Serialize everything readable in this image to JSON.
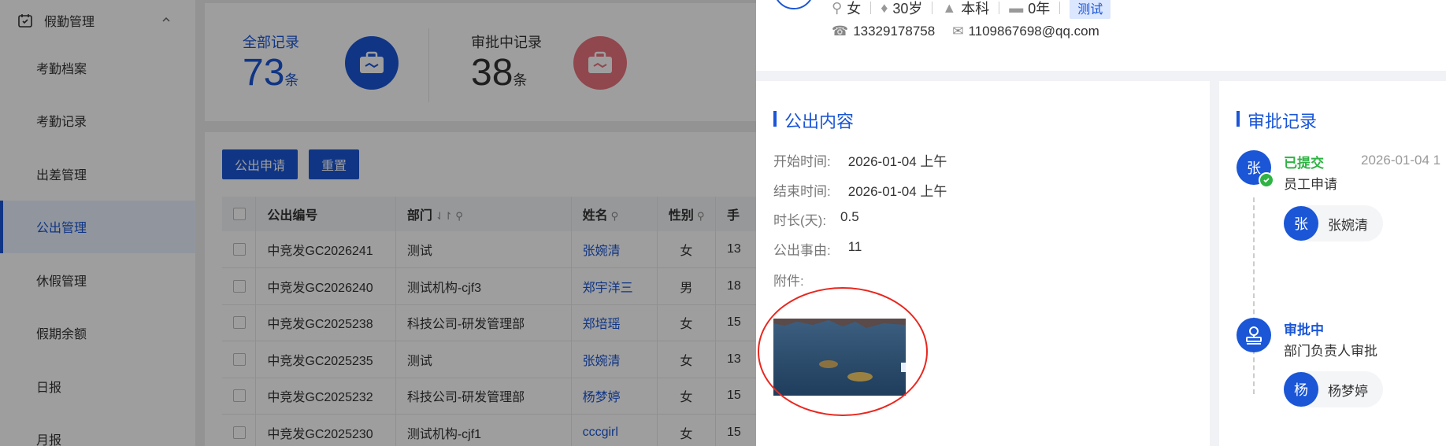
{
  "sidebar": {
    "group_label": "假勤管理",
    "items": [
      {
        "label": "考勤档案"
      },
      {
        "label": "考勤记录"
      },
      {
        "label": "出差管理"
      },
      {
        "label": "公出管理",
        "active": true
      },
      {
        "label": "休假管理"
      },
      {
        "label": "假期余额"
      },
      {
        "label": "日报"
      },
      {
        "label": "月报"
      }
    ]
  },
  "stats": {
    "all": {
      "label": "全部记录",
      "value": "73",
      "unit": "条"
    },
    "pending": {
      "label": "审批中记录",
      "value": "38",
      "unit": "条"
    }
  },
  "toolbar": {
    "apply_label": "公出申请",
    "reset_label": "重置"
  },
  "table": {
    "headers": {
      "number": "公出编号",
      "dept": "部门",
      "name": "姓名",
      "gender": "性别",
      "phone": "手"
    },
    "rows": [
      {
        "number": "中竞发GC2026241",
        "dept": "测试",
        "name": "张婉清",
        "gender": "女",
        "phone": "13"
      },
      {
        "number": "中竞发GC2026240",
        "dept": "测试机构-cjf3",
        "name": "郑宇洋三",
        "gender": "男",
        "phone": "18"
      },
      {
        "number": "中竞发GC2025238",
        "dept": "科技公司-研发管理部",
        "name": "郑培瑶",
        "gender": "女",
        "phone": "15"
      },
      {
        "number": "中竞发GC2025235",
        "dept": "测试",
        "name": "张婉清",
        "gender": "女",
        "phone": "13"
      },
      {
        "number": "中竞发GC2025232",
        "dept": "科技公司-研发管理部",
        "name": "杨梦婷",
        "gender": "女",
        "phone": "15"
      },
      {
        "number": "中竞发GC2025230",
        "dept": "测试机构-cjf1",
        "name": "cccgirl",
        "gender": "女",
        "phone": "15"
      }
    ]
  },
  "profile": {
    "gender": "女",
    "age": "30岁",
    "education": "本科",
    "tenure": "0年",
    "tag": "测试",
    "phone": "13329178758",
    "email": "1109867698@qq.com"
  },
  "content": {
    "title": "公出内容",
    "start_label": "开始时间:",
    "start_value": "2026-01-04 上午",
    "end_label": "结束时间:",
    "end_value": "2026-01-04 上午",
    "duration_label": "时长(天):",
    "duration_value": "0.5",
    "reason_label": "公出事由:",
    "reason_value": "11",
    "attachment_label": "附件:"
  },
  "approval": {
    "title": "审批记录",
    "steps": [
      {
        "avatar": "张",
        "status": "已提交",
        "date": "2026-01-04 1",
        "desc": "员工申请",
        "person_avatar": "张",
        "person_name": "张婉清"
      },
      {
        "status": "审批中",
        "desc": "部门负责人审批",
        "person_avatar": "杨",
        "person_name": "杨梦婷"
      }
    ]
  },
  "colors": {
    "primary": "#1a56d6",
    "success": "#2fb344",
    "danger": "#e8271f",
    "pending_icon": "#e8737f"
  }
}
